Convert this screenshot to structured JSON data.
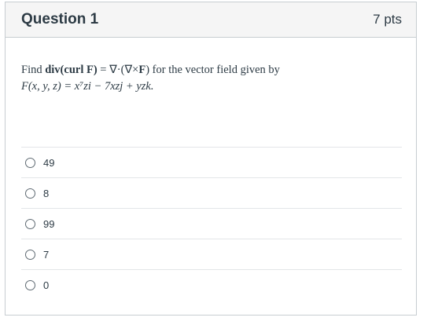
{
  "question": {
    "title": "Question 1",
    "points": "7 pts",
    "text_line1_prefix": "Find ",
    "text_line1_bold": "div(curl F)",
    "text_line1_mid": " = ∇·(∇×",
    "text_line1_boldF": "F",
    "text_line1_suffix": ") for the vector field given by",
    "text_line2": "F(x, y, z) = x⁷zi − 7xzj + yzk."
  },
  "answers": [
    {
      "label": "49"
    },
    {
      "label": "8"
    },
    {
      "label": "99"
    },
    {
      "label": "7"
    },
    {
      "label": "0"
    }
  ]
}
